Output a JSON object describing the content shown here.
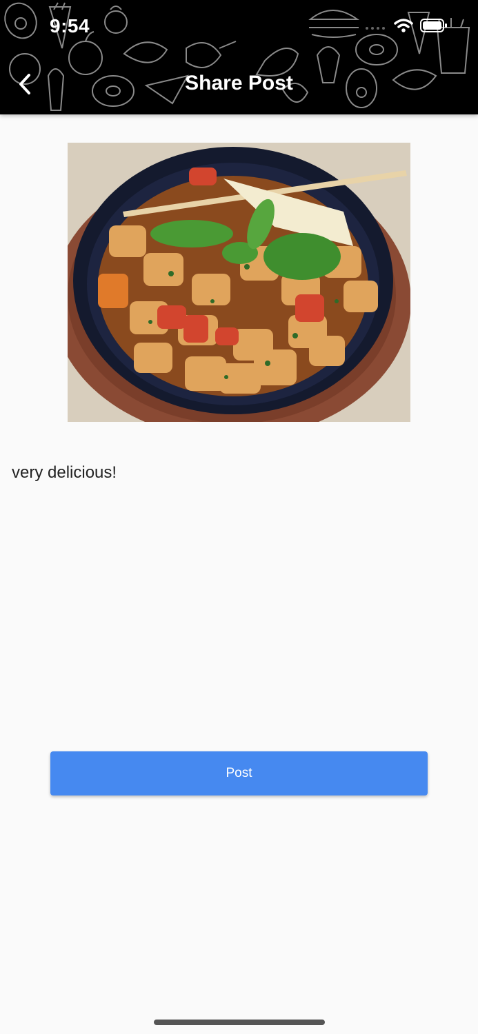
{
  "status_bar": {
    "time": "9:54",
    "icons": [
      "signal-icon",
      "wifi-icon",
      "battery-icon"
    ]
  },
  "nav": {
    "title": "Share Post",
    "back_icon": "chevron-left-icon"
  },
  "post": {
    "image_description_icon": "food-photo",
    "caption": "very delicious!"
  },
  "actions": {
    "post_label": "Post"
  },
  "colors": {
    "header_background": "#000000",
    "page_background": "#fafafa",
    "button_background": "#4689f0",
    "button_text": "#ffffff"
  }
}
